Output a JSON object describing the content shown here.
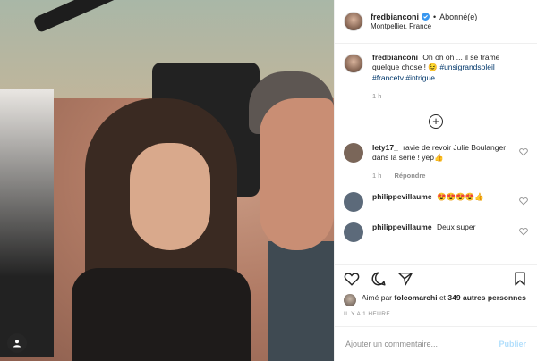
{
  "header": {
    "username": "fredbianconi",
    "follow_status": "Abonné(e)",
    "location": "Montpellier, France"
  },
  "caption": {
    "username": "fredbianconi",
    "text": "Oh oh oh ... il se trame quelque chose ! 😉",
    "hashtags": [
      "#unsigrandsoleil",
      "#francetv",
      "#intrigue"
    ],
    "time": "1 h"
  },
  "comments": [
    {
      "username": "lety17_",
      "text": "ravie de revoir Julie Boulanger dans la série ! yep👍",
      "time": "1 h",
      "reply_label": "Répondre",
      "avatar_color": "#7a6659"
    },
    {
      "username": "philippevillaume",
      "text": "😍😍😍😍👍",
      "avatar_color": "#5c6a7a"
    },
    {
      "username": "philippevillaume",
      "text": "Deux super",
      "avatar_color": "#5c6a7a"
    }
  ],
  "likes": {
    "prefix": "Aimé par",
    "first_liker": "folcomarchi",
    "connector": "et",
    "others": "349 autres personnes"
  },
  "time_ago": "IL Y A 1 HEURE",
  "add_comment": {
    "placeholder": "Ajouter un commentaire...",
    "publish_label": "Publier"
  },
  "colors": {
    "verified_blue": "#3897f0",
    "hashtag": "#00376b",
    "muted": "#8e8e8e",
    "publish_disabled": "#b2dffc"
  }
}
